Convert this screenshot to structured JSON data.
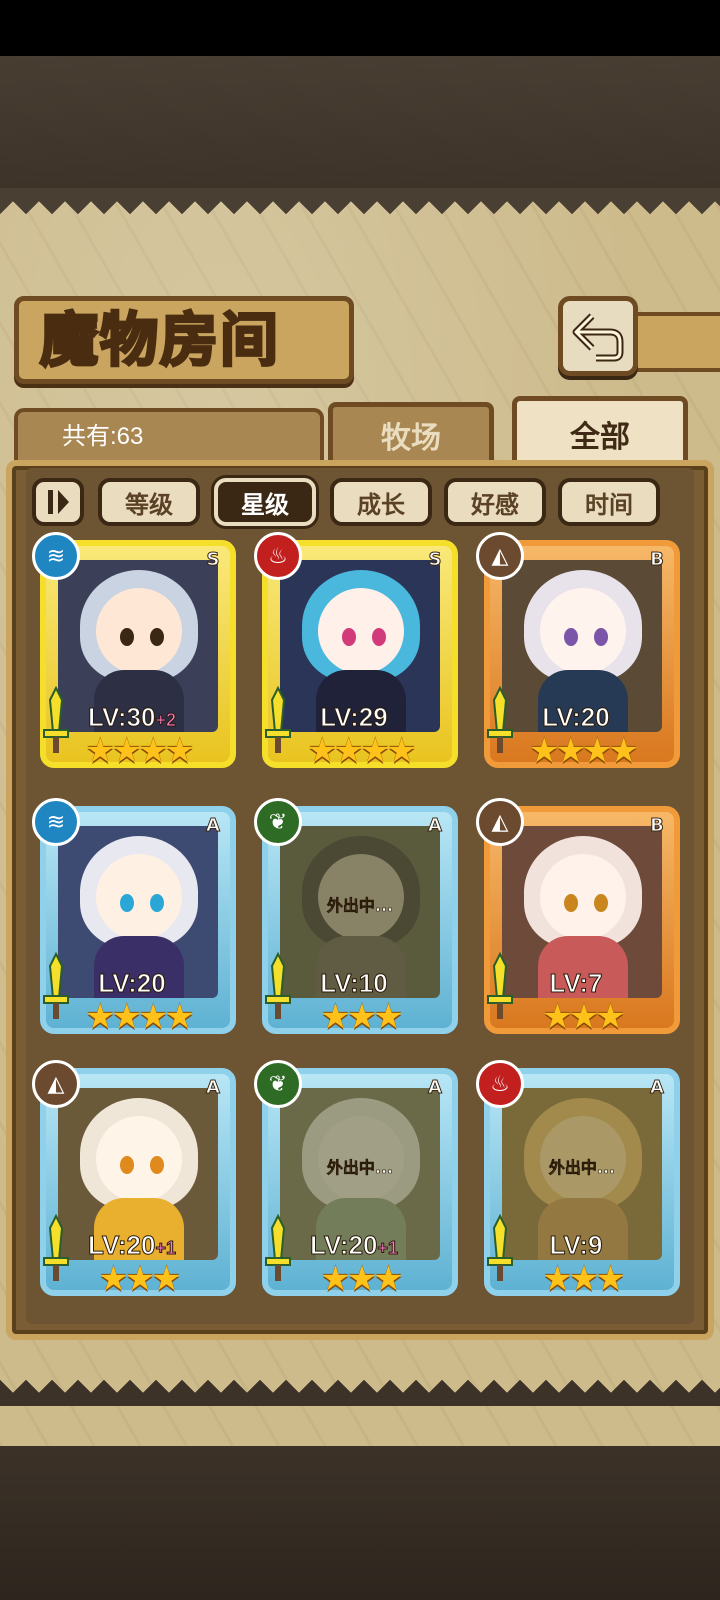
{
  "title": "魔物房间",
  "count_label": "共有:63",
  "tabs": {
    "ranch": "牧场",
    "all": "全部"
  },
  "sort": {
    "level": "等级",
    "star": "星级",
    "growth": "成长",
    "affection": "好感",
    "time": "时间",
    "active": "星级"
  },
  "colors": {
    "gold_frame": "#f5df2a",
    "orange_frame": "#f09a3a",
    "blue_frame": "#8fd0ea",
    "bonus_pink": "#ff7ac8"
  },
  "cards": [
    {
      "rank": "S",
      "element": "water-icon",
      "element_glyph": "≋",
      "level": "LV:30",
      "bonus": "+2",
      "stars": "★★★★",
      "star_count": 4,
      "away": ""
    },
    {
      "rank": "S",
      "element": "fire-icon",
      "element_glyph": "♨",
      "level": "LV:29",
      "bonus": "",
      "stars": "★★★★",
      "star_count": 4,
      "away": ""
    },
    {
      "rank": "B",
      "element": "earth-icon",
      "element_glyph": "◭",
      "level": "LV:20",
      "bonus": "",
      "stars": "★★★★",
      "star_count": 4,
      "away": ""
    },
    {
      "rank": "A",
      "element": "water-icon",
      "element_glyph": "≋",
      "level": "LV:20",
      "bonus": "",
      "stars": "★★★★",
      "star_count": 4,
      "away": ""
    },
    {
      "rank": "A",
      "element": "leaf-icon",
      "element_glyph": "❦",
      "level": "LV:10",
      "bonus": "",
      "stars": "★★★",
      "star_count": 3,
      "away": "外出中..."
    },
    {
      "rank": "B",
      "element": "earth-icon",
      "element_glyph": "◭",
      "level": "LV:7",
      "bonus": "",
      "stars": "★★★",
      "star_count": 3,
      "away": ""
    },
    {
      "rank": "A",
      "element": "earth-icon",
      "element_glyph": "◭",
      "level": "LV:20",
      "bonus": "+1",
      "stars": "★★★",
      "star_count": 3,
      "away": ""
    },
    {
      "rank": "A",
      "element": "leaf-icon",
      "element_glyph": "❦",
      "level": "LV:20",
      "bonus": "+1",
      "stars": "★★★",
      "star_count": 3,
      "away": "外出中..."
    },
    {
      "rank": "A",
      "element": "fire-icon",
      "element_glyph": "♨",
      "level": "LV:9",
      "bonus": "",
      "stars": "★★★",
      "star_count": 3,
      "away": "外出中..."
    }
  ]
}
